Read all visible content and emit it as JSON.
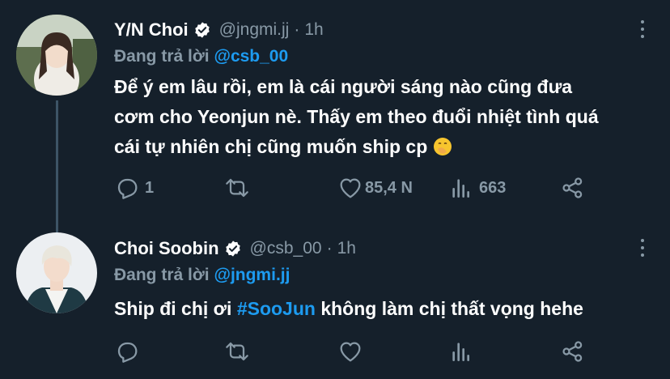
{
  "tweets": [
    {
      "name": "Y/N Choi",
      "handle": "@jngmi.jj",
      "sep": "·",
      "time": "1h",
      "replying_prefix": "Đang trả lời",
      "replying_to": "@csb_00",
      "text_line1": "Để ý em lâu rồi, em là cái người sáng nào cũng đưa",
      "text_line2": "cơm cho Yeonjun nè. Thấy em theo đuổi nhiệt tình quá",
      "text_line3": "cái tự nhiên chị cũng muốn ship cp",
      "emoji": "hand-over-mouth-emoji",
      "replies": "1",
      "retweets": "",
      "likes": "85,4 N",
      "views": "663"
    },
    {
      "name": "Choi Soobin",
      "handle": "@csb_00",
      "sep": "·",
      "time": "1h",
      "replying_prefix": "Đang trả lời",
      "replying_to": "@jngmi.jj",
      "text_before": "Ship đi chị ơi ",
      "hashtag": "#SooJun",
      "text_after": " không làm chị thất vọng hehe",
      "replies": "",
      "retweets": "",
      "likes": "",
      "views": ""
    }
  ],
  "colors": {
    "background": "#15202b",
    "accent": "#1d9bf0",
    "muted": "#8899a6",
    "thread_line": "#3d5466"
  }
}
